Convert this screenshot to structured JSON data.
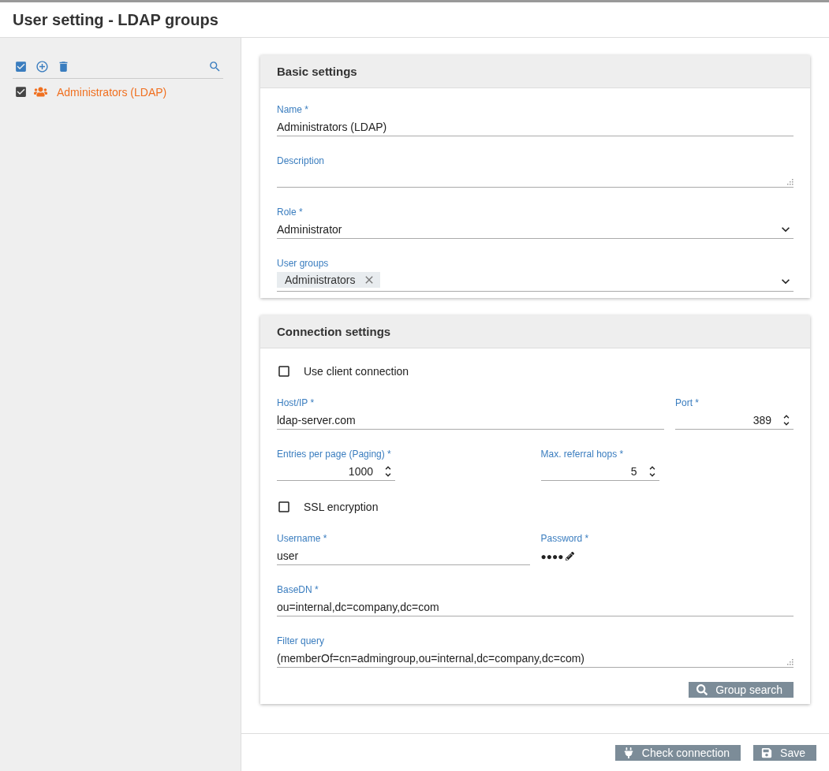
{
  "page": {
    "title": "User setting - LDAP groups"
  },
  "sidebar": {
    "toolbar": [
      {
        "kind": "select-all"
      },
      {
        "kind": "add"
      },
      {
        "kind": "delete"
      },
      {
        "kind": "search"
      }
    ],
    "items": [
      {
        "label": "Administrators (LDAP)",
        "checked": true,
        "selected": true
      }
    ]
  },
  "sections": [
    {
      "title": "Basic settings",
      "rows": [
        [
          {
            "kind": "text",
            "label": "Name *",
            "value": "Administrators (LDAP)"
          }
        ],
        [
          {
            "kind": "textarea",
            "label": "Description"
          }
        ],
        [
          {
            "kind": "select",
            "label": "Role *",
            "value": "Administrator"
          }
        ],
        [
          {
            "kind": "tags",
            "label": "User groups",
            "tags": [
              "Administrators"
            ]
          }
        ]
      ]
    },
    {
      "title": "Connection settings",
      "rows": [
        [
          {
            "kind": "checkbox",
            "label": "Use client connection",
            "checked": false
          }
        ],
        [
          {
            "kind": "text",
            "label": "Host/IP *",
            "value": "ldap-server.com"
          },
          {
            "kind": "number",
            "label": "Port *",
            "value": "389"
          }
        ],
        [
          {
            "kind": "number",
            "label": "Entries per page (Paging) *",
            "value": "1000"
          },
          {
            "kind": "number",
            "label": "Max. referral hops *",
            "value": "5"
          }
        ],
        [
          {
            "kind": "checkbox",
            "label": "SSL encryption",
            "checked": false
          }
        ],
        [
          {
            "kind": "text",
            "label": "Username *",
            "value": "user"
          },
          {
            "kind": "password",
            "label": "Password *",
            "value": "●●●●"
          }
        ],
        [
          {
            "kind": "text",
            "label": "BaseDN *",
            "value": "ou=internal,dc=company,dc=com"
          }
        ],
        [
          {
            "kind": "textarea",
            "label": "Filter query",
            "value": "(memberOf=cn=admingroup,ou=internal,dc=company,dc=com)"
          }
        ]
      ],
      "action": {
        "label": "Group search",
        "kind": "search"
      }
    }
  ],
  "footer": [
    {
      "label": "Check connection",
      "kind": "check"
    },
    {
      "label": "Save",
      "kind": "save"
    }
  ]
}
